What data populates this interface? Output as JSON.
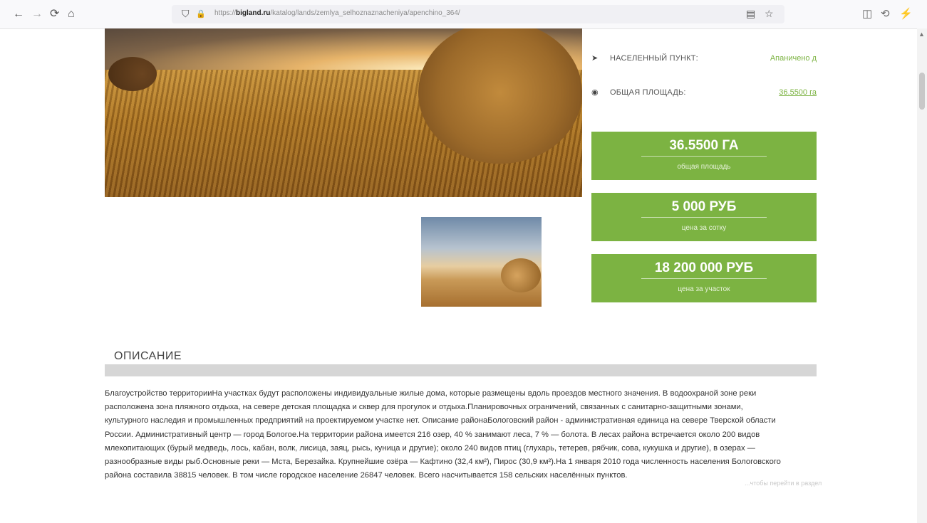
{
  "browser": {
    "url_prefix": "https://",
    "url_domain": "bigland.ru",
    "url_path": "/katalog/lands/zemlya_selhoznaznacheniya/apenchino_364/"
  },
  "info": {
    "locality_label": "НАСЕЛЕННЫЙ ПУНКТ:",
    "locality_value": "Апаничено д",
    "area_label": "ОБЩАЯ ПЛОЩАДЬ:",
    "area_value": "36.5500 га"
  },
  "cards": [
    {
      "value": "36.5500 ГА",
      "caption": "общая площадь"
    },
    {
      "value": "5 000 РУБ",
      "caption": "цена за сотку"
    },
    {
      "value": "18 200 000 РУБ",
      "caption": "цена за участок"
    }
  ],
  "description": {
    "title": "ОПИСАНИЕ",
    "text": "Благоустройство территорииНа участках будут расположены индивидуальные жилые дома, которые размещены вдоль проездов местного значения.  В водоохраной зоне реки расположена зона пляжного отдыха, на севере детская площадка и сквер для прогулок и отдыха.Планировочных ограничений, связанных с санитарно-защитными зонами, культурного наследия и промышленных предприятий на проектируемом участке нет. Описание районаБологовский район - административная единица на севере Тверской области России. Административный центр — город Бологое.На территории района имеется 216 озер, 40 % занимают леса, 7 % — болота. В лесах района встречается около 200 видов млекопитающих (бурый медведь, лось, кабан, волк, лисица, заяц, рысь, куница и другие); около 240 видов птиц (глухарь, тетерев, рябчик, сова, кукушка и другие), в озерах — разнообразные виды рыб.Основные реки — Мста, Березайка. Крупнейшие озёра — Кафтино (32,4 км²), Пирос (30,9 км²).На 1 января 2010 года численность населения Бологовского района составила 38815 человек. В том числе городское население 26847 человек. Всего насчитывается 158 сельских населённых пунктов."
  },
  "ghost_text": "...чтобы перейти в раздел",
  "icons": {
    "back": "←",
    "forward": "→",
    "reload": "⟳",
    "home": "⌂",
    "shield": "⛉",
    "lock": "🔒",
    "reader": "▤",
    "star": "☆",
    "pocket": "◫",
    "extensions": "⟲",
    "rss": "⚡",
    "locality": "➤",
    "area": "◉"
  }
}
